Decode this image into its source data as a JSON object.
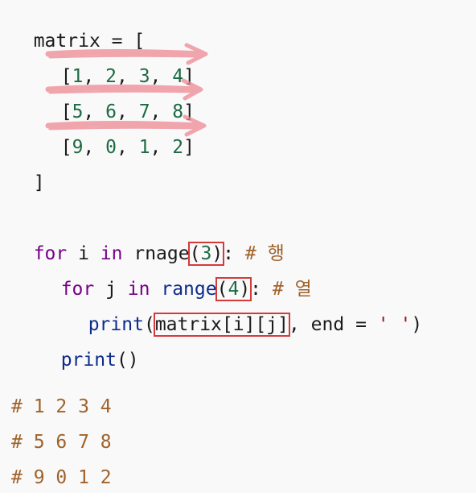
{
  "code": {
    "matrix_open": "matrix = [",
    "rows": [
      [
        "[",
        "1",
        ", ",
        "2",
        ", ",
        "3",
        ", ",
        "4",
        "]"
      ],
      [
        "[",
        "5",
        ", ",
        "6",
        ", ",
        "7",
        ", ",
        "8",
        "]"
      ],
      [
        "[",
        "9",
        ", ",
        "0",
        ", ",
        "1",
        ", ",
        "2",
        "]"
      ]
    ],
    "matrix_close": "]",
    "for_outer": {
      "kw_for": "for",
      "var": " i ",
      "kw_in": "in",
      "func": " rnage",
      "open": "(",
      "arg": "3",
      "close": ")",
      "colon": ": ",
      "comment": "# 행"
    },
    "for_inner": {
      "kw_for": "for",
      "var": " j ",
      "kw_in": "in",
      "func": " range",
      "open": "(",
      "arg": "4",
      "close": ")",
      "colon": ": ",
      "comment": "# 열"
    },
    "print_call": {
      "func": "print",
      "open": "(",
      "arg": "matrix[i][j]",
      "rest": ", end = ",
      "str": "' '",
      "close": ")"
    },
    "print_empty": {
      "func": "print",
      "parens": "()"
    },
    "output_comments": [
      "# 1 2 3 4",
      "# 5 6 7 8",
      "# 9 0 1 2"
    ]
  },
  "colors": {
    "keyword": "#770088",
    "function": "#0d2c8c",
    "number": "#1d6b43",
    "comment": "#a0622b",
    "highlight_box": "#d33b3b",
    "arrow": "#ee8a94"
  }
}
